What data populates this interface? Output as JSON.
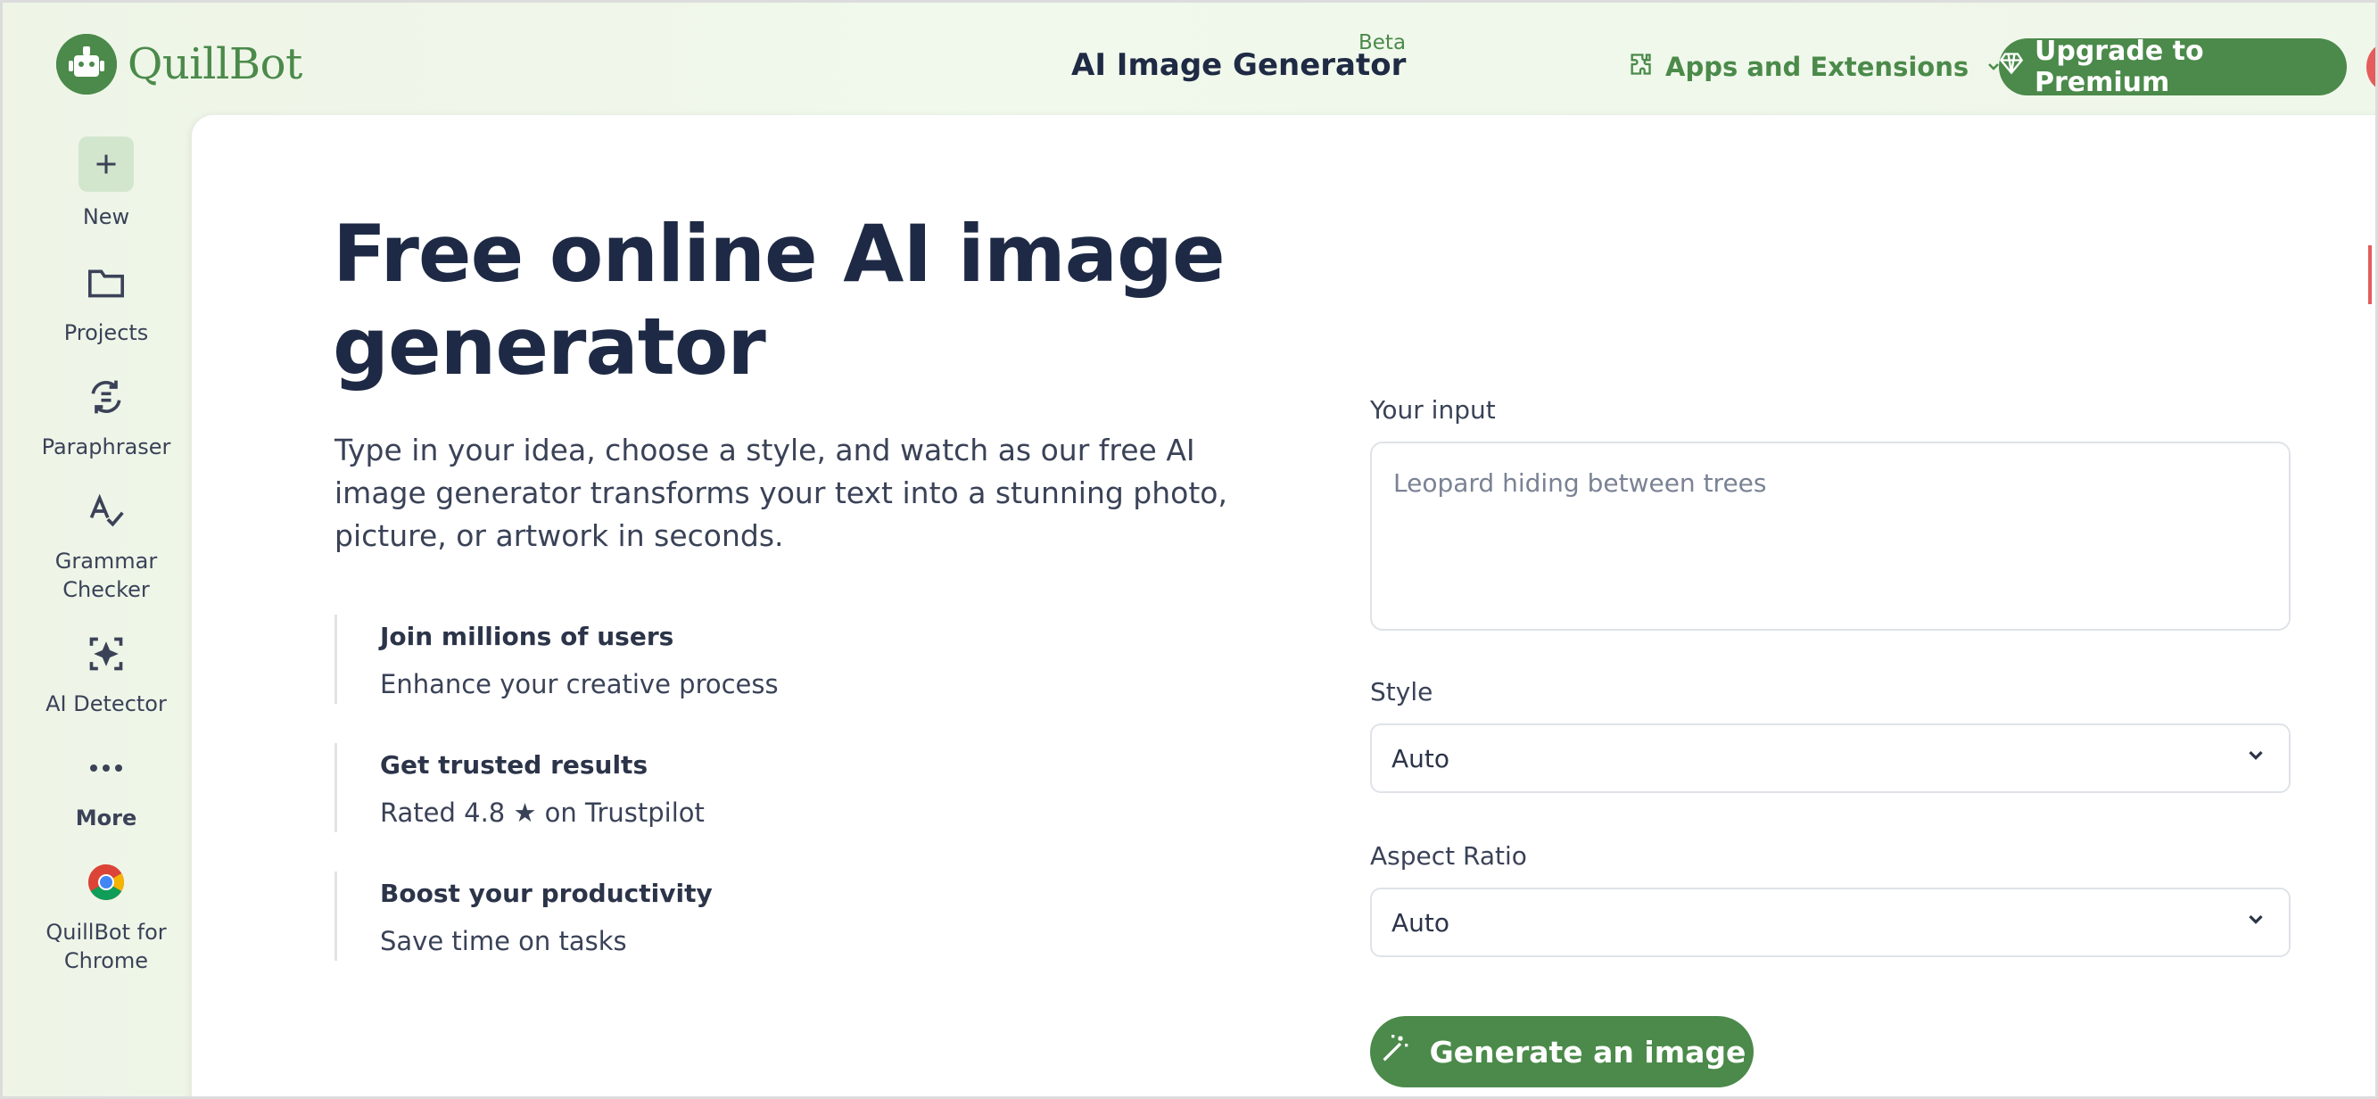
{
  "header": {
    "logo_text": "QuillBot",
    "app_title": "AI Image Generator",
    "beta_label": "Beta",
    "apps_label": "Apps and Extensions",
    "upgrade_label": "Upgrade to Premium"
  },
  "sidebar": {
    "items": [
      {
        "label": "New",
        "icon": "plus-icon"
      },
      {
        "label": "Projects",
        "icon": "folder-icon"
      },
      {
        "label": "Paraphraser",
        "icon": "paraphraser-icon"
      },
      {
        "label": "Grammar Checker",
        "icon": "grammar-check-icon"
      },
      {
        "label": "AI Detector",
        "icon": "ai-detector-icon"
      },
      {
        "label": "More",
        "icon": "ellipsis-icon"
      },
      {
        "label": "QuillBot for Chrome",
        "icon": "chrome-icon"
      }
    ]
  },
  "hero": {
    "title": "Free online AI image generator",
    "description": "Type in your idea, choose a style, and watch as our free AI image generator transforms your text into a stunning photo, picture, or artwork in seconds."
  },
  "features": [
    {
      "title": "Join millions of users",
      "desc": "Enhance your creative process"
    },
    {
      "title": "Get trusted results",
      "desc": "Rated 4.8 ★ on Trustpilot"
    },
    {
      "title": "Boost your productivity",
      "desc": "Save time on tasks"
    }
  ],
  "form": {
    "input_label": "Your input",
    "input_placeholder": "Leopard hiding between trees",
    "input_value": "",
    "style_label": "Style",
    "style_value": "Auto",
    "aspect_label": "Aspect Ratio",
    "aspect_value": "Auto",
    "generate_label": "Generate an image"
  },
  "colors": {
    "brand": "#4b8a4a",
    "heading": "#1e2a45",
    "background": "#eff7ea"
  }
}
